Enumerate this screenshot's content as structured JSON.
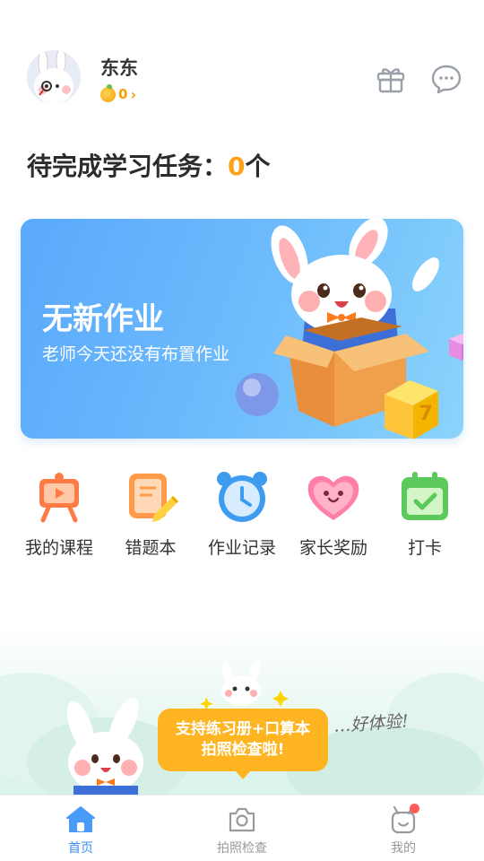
{
  "header": {
    "username": "东东",
    "coins": "0",
    "coins_chevron": "›"
  },
  "tasks": {
    "label": "待完成学习任务：",
    "count": "0",
    "unit": "个"
  },
  "banner": {
    "title": "无新作业",
    "subtitle": "老师今天还没有布置作业",
    "cube_number": "7"
  },
  "quick_menu": [
    {
      "label": "我的课程",
      "icon": "easel-play-icon"
    },
    {
      "label": "错题本",
      "icon": "notebook-pencil-icon"
    },
    {
      "label": "作业记录",
      "icon": "alarm-clock-icon"
    },
    {
      "label": "家长奖励",
      "icon": "smiling-heart-icon"
    },
    {
      "label": "打卡",
      "icon": "calendar-check-icon"
    }
  ],
  "promo": {
    "line1": "支持练习册+口算本",
    "line2": "拍照检查啦!",
    "handwriting": "…好体验!"
  },
  "bottom_nav": [
    {
      "label": "首页",
      "icon": "home-icon",
      "active": true
    },
    {
      "label": "拍照检查",
      "icon": "camera-icon",
      "active": false
    },
    {
      "label": "我的",
      "icon": "profile-bunny-icon",
      "active": false,
      "badge": true
    }
  ],
  "colors": {
    "accent_orange": "#ffa21a",
    "banner_blue": "#5aa9fb",
    "nav_active": "#3d8df5",
    "promo_orange": "#ffb522"
  }
}
